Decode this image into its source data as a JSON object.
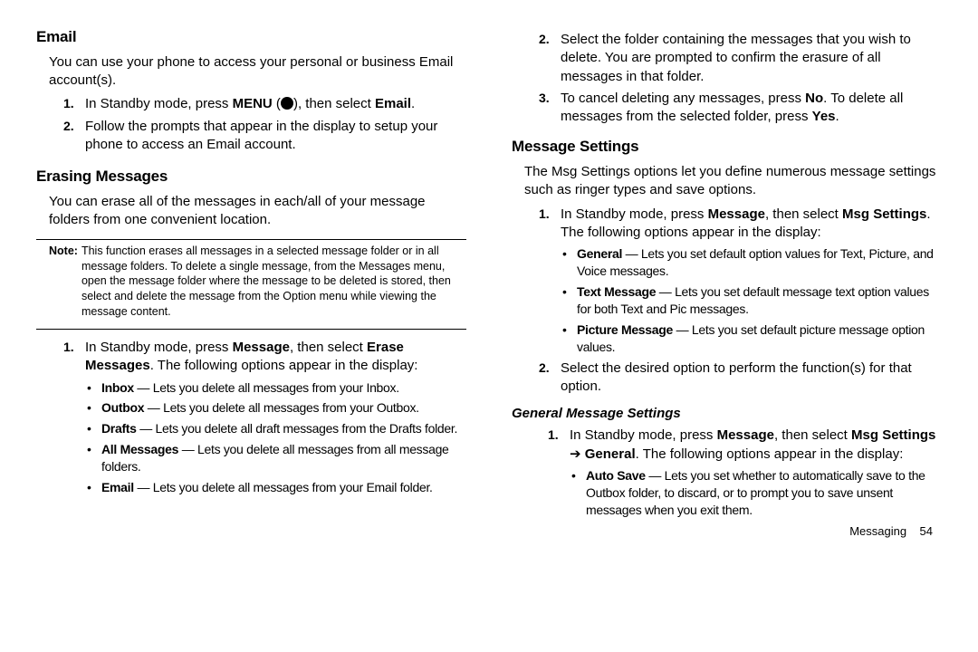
{
  "left": {
    "email_h": "Email",
    "email_intro": "You can use your phone to access your personal or business Email account(s).",
    "email_s1_a": "In Standby mode, press ",
    "email_s1_menu": "MENU",
    "email_s1_b": ", then select ",
    "email_s1_email": "Email",
    "email_s1_c": ".",
    "email_s2": "Follow the prompts that appear in the display to setup your phone to access an Email account.",
    "erase_h": "Erasing Messages",
    "erase_intro": "You can erase all of the messages in each/all of your message folders from one convenient location.",
    "note_label": "Note:",
    "note_body": "This function erases all messages in a selected message folder or in all message folders. To delete a single message, from the Messages menu, open the message folder where the message to be deleted is stored, then select and delete the message from the Option menu while viewing the message content.",
    "erase_s1_a": "In Standby mode, press ",
    "erase_s1_msg": "Message",
    "erase_s1_b": ", then select ",
    "erase_s1_erase": "Erase Messages",
    "erase_s1_c": ". The following options appear in the display:",
    "b_inbox_t": "Inbox",
    "b_inbox_d": " — Lets you delete all messages from your Inbox.",
    "b_outbox_t": "Outbox",
    "b_outbox_d": " — Lets you delete all messages from your Outbox.",
    "b_drafts_t": "Drafts",
    "b_drafts_d": " — Lets you delete all draft messages from the Drafts folder.",
    "b_all_t": "All Messages",
    "b_all_d": " — Lets you delete all messages from all message folders.",
    "b_email_t": "Email",
    "b_email_d": " — Lets you delete all messages from your Email folder."
  },
  "right": {
    "s2": "Select the folder containing the messages that you wish to delete. You are prompted to confirm the erasure of all messages in that folder.",
    "s3_a": "To cancel deleting any messages, press ",
    "s3_no": "No",
    "s3_b": ". To delete all messages from the selected folder, press ",
    "s3_yes": "Yes",
    "s3_c": ".",
    "mset_h": "Message Settings",
    "mset_intro": "The Msg Settings options let you define numerous message settings such as ringer types and save options.",
    "mset_s1_a": "In Standby mode, press ",
    "mset_s1_msg": "Message",
    "mset_s1_b": ", then select ",
    "mset_s1_ms": "Msg Settings",
    "mset_s1_c": ". The following options appear in the display:",
    "b_gen_t": "General",
    "b_gen_d": " — Lets you set default option values for Text, Picture, and Voice messages.",
    "b_txt_t": "Text Message",
    "b_txt_d": " — Lets you set default message text option values for both Text and Pic messages.",
    "b_pic_t": "Picture Message",
    "b_pic_d": " — Lets you set default picture message option values.",
    "mset_s2": "Select the desired option to perform the function(s) for that option.",
    "gms_h": "General Message Settings",
    "gms_s1_a": "In Standby mode, press ",
    "gms_s1_msg": "Message",
    "gms_s1_b": ", then select ",
    "gms_s1_ms": "Msg Settings",
    "gms_s1_arrow": " ➔ ",
    "gms_s1_gen": "General",
    "gms_s1_c": ". The following options appear in the display:",
    "b_auto_t": "Auto Save",
    "b_auto_d": " — Lets you set whether to automatically save to the Outbox folder, to discard, or to prompt you to save unsent messages when you exit them."
  },
  "footer_label": "Messaging",
  "footer_page": "54"
}
